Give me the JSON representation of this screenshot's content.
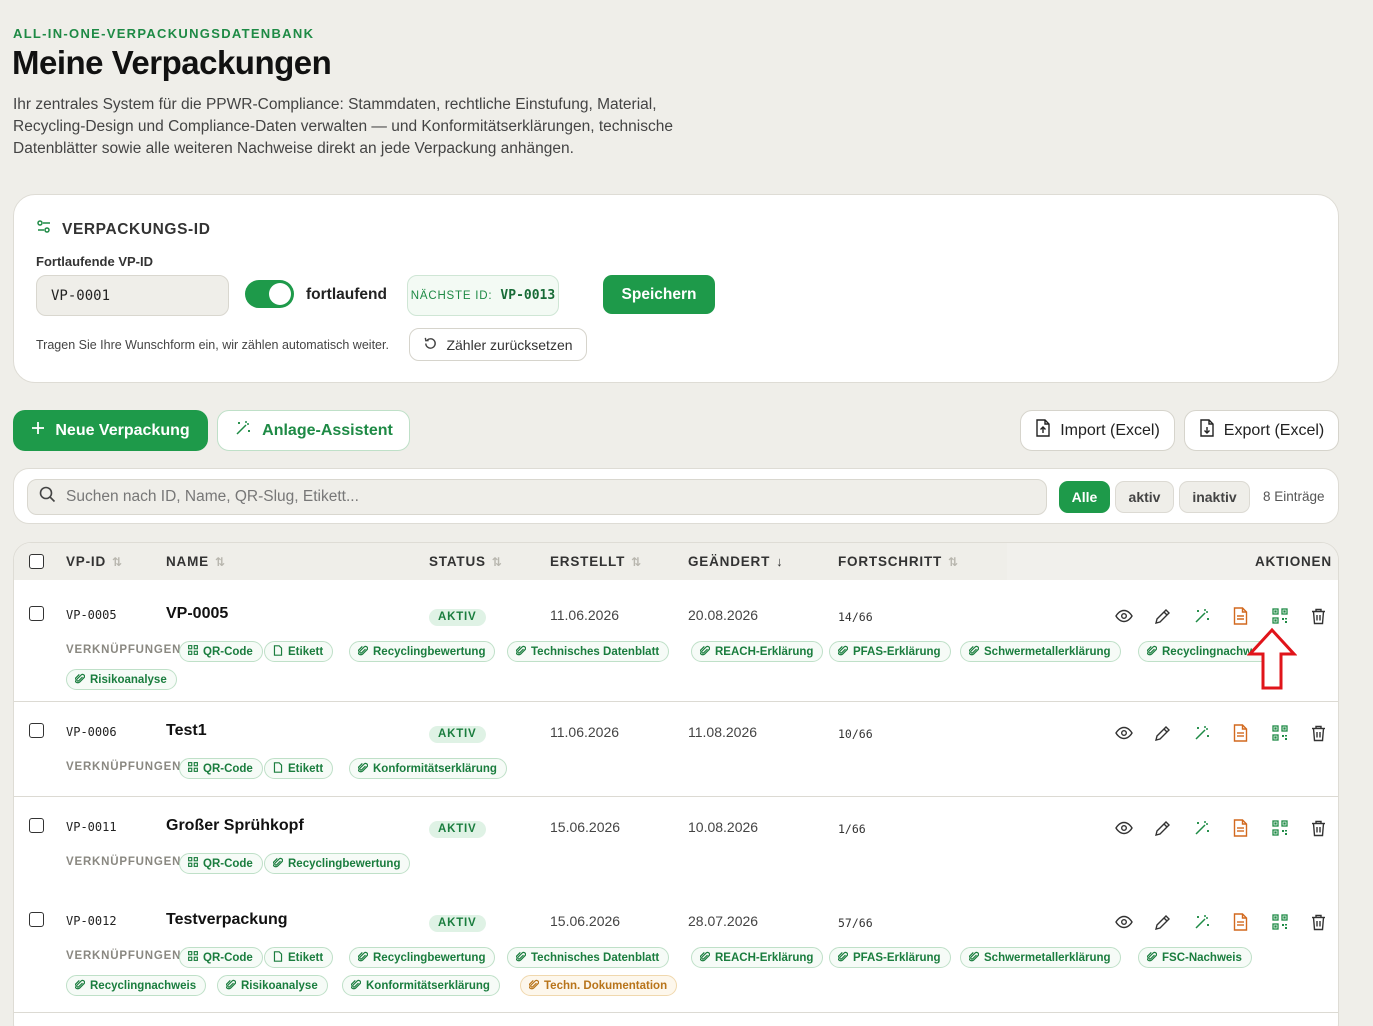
{
  "header": {
    "eyebrow": "ALL-IN-ONE-VERPACKUNGSDATENBANK",
    "title": "Meine Verpackungen",
    "intro": "Ihr zentrales System für die PPWR-Compliance: Stammdaten, rechtliche Einstufung, Material, Recycling-Design und Compliance-Daten verwalten — und Konformitätserklärungen, technische Datenblätter sowie alle weiteren Nachweise direkt an jede Verpackung anhängen."
  },
  "id_card": {
    "heading": "VERPACKUNGS-ID",
    "field_label": "Fortlaufende VP-ID",
    "field_value": "VP-0001",
    "toggle_label": "fortlaufend",
    "toggle_on": true,
    "next_id_label": "NÄCHSTE ID:",
    "next_id_value": "VP-0013",
    "save_label": "Speichern",
    "hint": "Tragen Sie Ihre Wunschform ein, wir zählen automatisch weiter.",
    "reset_label": "Zähler zurücksetzen"
  },
  "toolbar": {
    "new_label": "Neue Verpackung",
    "assistant_label": "Anlage-Assistent",
    "import_label": "Import (Excel)",
    "export_label": "Export (Excel)"
  },
  "search": {
    "placeholder": "Suchen nach ID, Name, QR-Slug, Etikett...",
    "value": "",
    "filters": [
      "Alle",
      "aktiv",
      "inaktiv"
    ],
    "selected_filter": "Alle",
    "count": "8 Einträge"
  },
  "table": {
    "columns": {
      "id": "VP-ID",
      "name": "NAME",
      "status": "STATUS",
      "created": "ERSTELLT",
      "changed": "GEÄNDERT",
      "progress": "FORTSCHRITT",
      "actions": "AKTIONEN"
    },
    "links_label": "VERKNÜPFUNGEN",
    "rows": [
      {
        "id": "VP-0005",
        "name": "VP-0005",
        "status": "AKTIV",
        "created": "11.06.2026",
        "changed": "20.08.2026",
        "progress": "14/66",
        "links": [
          "QR-Code",
          "Etikett",
          "Recyclingbewertung",
          "Technisches Datenblatt",
          "REACH-Erklärung",
          "PFAS-Erklärung",
          "Schwermetallerklärung",
          "Recyclingnachweis",
          "Risikoanalyse"
        ]
      },
      {
        "id": "VP-0006",
        "name": "Test1",
        "status": "AKTIV",
        "created": "11.06.2026",
        "changed": "11.08.2026",
        "progress": "10/66",
        "links": [
          "QR-Code",
          "Etikett",
          "Konformitätserklärung"
        ]
      },
      {
        "id": "VP-0011",
        "name": "Großer Sprühkopf",
        "status": "AKTIV",
        "created": "15.06.2026",
        "changed": "10.08.2026",
        "progress": "1/66",
        "links": [
          "QR-Code",
          "Recyclingbewertung"
        ]
      },
      {
        "id": "VP-0012",
        "name": "Testverpackung",
        "status": "AKTIV",
        "created": "15.06.2026",
        "changed": "28.07.2026",
        "progress": "57/66",
        "links": [
          "QR-Code",
          "Etikett",
          "Recyclingbewertung",
          "Technisches Datenblatt",
          "REACH-Erklärung",
          "PFAS-Erklärung",
          "Schwermetallerklärung",
          "FSC-Nachweis",
          "Recyclingnachweis",
          "Risikoanalyse",
          "Konformitätserklärung",
          "Techn. Dokumentation"
        ]
      }
    ]
  },
  "colors": {
    "accent": "#1e9a4a",
    "accent_text": "#1e8a45",
    "warning": "#b8741a",
    "annotation": "#e0141a"
  },
  "icons": [
    "filter-id-icon",
    "plus-icon",
    "wand-icon",
    "file-upload-icon",
    "file-download-icon",
    "search-icon",
    "reset-icon",
    "eye-icon",
    "pencil-icon",
    "wand-icon",
    "document-icon",
    "qr-code-icon",
    "trash-icon",
    "paperclip-icon",
    "red-arrow-up-icon"
  ]
}
